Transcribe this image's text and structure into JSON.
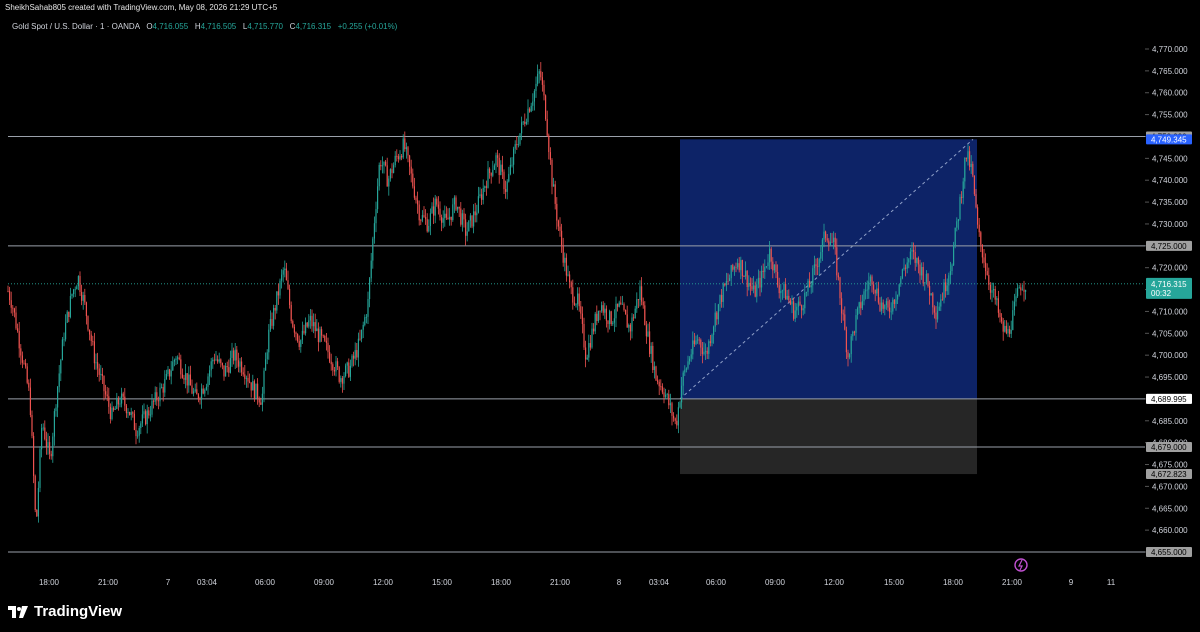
{
  "header": {
    "credit": "SheikhSahab805 created with TradingView.com, May 08, 2026 21:29 UTC+5",
    "symbol": "Gold Spot / U.S. Dollar · 1 · OANDA",
    "o_label": "O",
    "o_value": "4,716.055",
    "h_label": "H",
    "h_value": "4,716.505",
    "l_label": "L",
    "l_value": "4,715.770",
    "c_label": "C",
    "c_value": "4,716.315",
    "change": "+0.255 (+0.01%)"
  },
  "footer": {
    "logo_text": "TradingView"
  },
  "colors": {
    "background": "#000000",
    "up": "#26a69a",
    "down": "#ef5350",
    "target_zone": "#0d2367",
    "stop_zone": "#262626",
    "level_line": "#9aa0aa",
    "price_tag": "#26a69a",
    "target_tag": "#2962ff"
  },
  "chart_data": {
    "type": "candlestick",
    "symbol": "XAUUSD",
    "timeframe": "1",
    "y_axis_ticks": [
      "4,770.000",
      "4,765.000",
      "4,760.000",
      "4,755.000",
      "4,750.000",
      "4,745.000",
      "4,740.000",
      "4,735.000",
      "4,730.000",
      "4,725.000",
      "4,720.000",
      "4,715.000",
      "4,710.000",
      "4,705.000",
      "4,700.000",
      "4,695.000",
      "4,690.000",
      "4,685.000",
      "4,680.000",
      "4,675.000",
      "4,670.000",
      "4,665.000",
      "4,660.000",
      "4,655.000"
    ],
    "ylim": [
      4652.5,
      4773.5
    ],
    "x_axis_ticks": [
      "18:00",
      "21:00",
      "7",
      "03:04",
      "06:00",
      "09:00",
      "12:00",
      "15:00",
      "18:00",
      "21:00",
      "8",
      "03:04",
      "06:00",
      "09:00",
      "12:00",
      "15:00",
      "18:00",
      "21:00",
      "9",
      "11"
    ],
    "horizontal_levels": [
      {
        "value": 4750.0,
        "label": "4,750.000"
      },
      {
        "value": 4725.0,
        "label": "4,725.000"
      },
      {
        "value": 4690.0,
        "label": "4,690.000"
      },
      {
        "value": 4679.0,
        "label": "4,679.000"
      },
      {
        "value": 4655.0,
        "label": "4,655.000"
      }
    ],
    "position_tool": {
      "entry": 4689.995,
      "entry_label": "4,689.995",
      "target": 4749.345,
      "target_label": "4,749.345",
      "stop": 4672.823,
      "stop_label": "4,672.823"
    },
    "last_price": {
      "value": 4716.315,
      "label": "4,716.315",
      "countdown": "00:32"
    },
    "path": [
      [
        0,
        4720
      ],
      [
        12,
        4712
      ],
      [
        22,
        4700
      ],
      [
        30,
        4690
      ],
      [
        36,
        4660
      ],
      [
        42,
        4685
      ],
      [
        50,
        4676
      ],
      [
        56,
        4690
      ],
      [
        64,
        4705
      ],
      [
        72,
        4714
      ],
      [
        78,
        4718
      ],
      [
        86,
        4710
      ],
      [
        94,
        4700
      ],
      [
        104,
        4692
      ],
      [
        112,
        4686
      ],
      [
        120,
        4690
      ],
      [
        128,
        4688
      ],
      [
        136,
        4683
      ],
      [
        146,
        4686
      ],
      [
        156,
        4690
      ],
      [
        166,
        4694
      ],
      [
        176,
        4700
      ],
      [
        186,
        4695
      ],
      [
        196,
        4690
      ],
      [
        206,
        4694
      ],
      [
        214,
        4700
      ],
      [
        224,
        4696
      ],
      [
        234,
        4700
      ],
      [
        244,
        4697
      ],
      [
        254,
        4692
      ],
      [
        262,
        4690
      ],
      [
        268,
        4704
      ],
      [
        276,
        4712
      ],
      [
        284,
        4720
      ],
      [
        292,
        4708
      ],
      [
        300,
        4703
      ],
      [
        310,
        4708
      ],
      [
        320,
        4704
      ],
      [
        330,
        4700
      ],
      [
        340,
        4695
      ],
      [
        350,
        4697
      ],
      [
        360,
        4703
      ],
      [
        368,
        4712
      ],
      [
        374,
        4730
      ],
      [
        380,
        4745
      ],
      [
        388,
        4740
      ],
      [
        396,
        4745
      ],
      [
        404,
        4748
      ],
      [
        412,
        4740
      ],
      [
        420,
        4732
      ],
      [
        428,
        4730
      ],
      [
        436,
        4735
      ],
      [
        446,
        4730
      ],
      [
        456,
        4735
      ],
      [
        466,
        4728
      ],
      [
        476,
        4733
      ],
      [
        486,
        4740
      ],
      [
        496,
        4745
      ],
      [
        506,
        4738
      ],
      [
        516,
        4748
      ],
      [
        526,
        4755
      ],
      [
        534,
        4760
      ],
      [
        540,
        4765
      ],
      [
        546,
        4755
      ],
      [
        552,
        4740
      ],
      [
        558,
        4730
      ],
      [
        564,
        4722
      ],
      [
        570,
        4715
      ],
      [
        578,
        4712
      ],
      [
        586,
        4700
      ],
      [
        592,
        4705
      ],
      [
        600,
        4712
      ],
      [
        610,
        4708
      ],
      [
        620,
        4711
      ],
      [
        630,
        4706
      ],
      [
        640,
        4715
      ],
      [
        648,
        4704
      ],
      [
        656,
        4695
      ],
      [
        664,
        4692
      ],
      [
        670,
        4688
      ],
      [
        676,
        4684
      ],
      [
        682,
        4694
      ],
      [
        690,
        4700
      ],
      [
        698,
        4704
      ],
      [
        706,
        4700
      ],
      [
        714,
        4708
      ],
      [
        722,
        4714
      ],
      [
        730,
        4718
      ],
      [
        738,
        4722
      ],
      [
        746,
        4718
      ],
      [
        754,
        4714
      ],
      [
        762,
        4718
      ],
      [
        770,
        4724
      ],
      [
        778,
        4716
      ],
      [
        786,
        4714
      ],
      [
        794,
        4710
      ],
      [
        802,
        4712
      ],
      [
        810,
        4716
      ],
      [
        818,
        4722
      ],
      [
        826,
        4728
      ],
      [
        834,
        4725
      ],
      [
        842,
        4710
      ],
      [
        848,
        4700
      ],
      [
        856,
        4708
      ],
      [
        864,
        4714
      ],
      [
        872,
        4718
      ],
      [
        880,
        4712
      ],
      [
        888,
        4710
      ],
      [
        896,
        4714
      ],
      [
        904,
        4720
      ],
      [
        912,
        4723
      ],
      [
        920,
        4720
      ],
      [
        928,
        4716
      ],
      [
        936,
        4710
      ],
      [
        944,
        4715
      ],
      [
        952,
        4722
      ],
      [
        960,
        4735
      ],
      [
        966,
        4746
      ],
      [
        972,
        4742
      ],
      [
        978,
        4728
      ],
      [
        984,
        4722
      ],
      [
        990,
        4716
      ],
      [
        996,
        4712
      ],
      [
        1002,
        4706
      ],
      [
        1008,
        4705
      ],
      [
        1014,
        4710
      ],
      [
        1020,
        4716.3
      ]
    ]
  }
}
